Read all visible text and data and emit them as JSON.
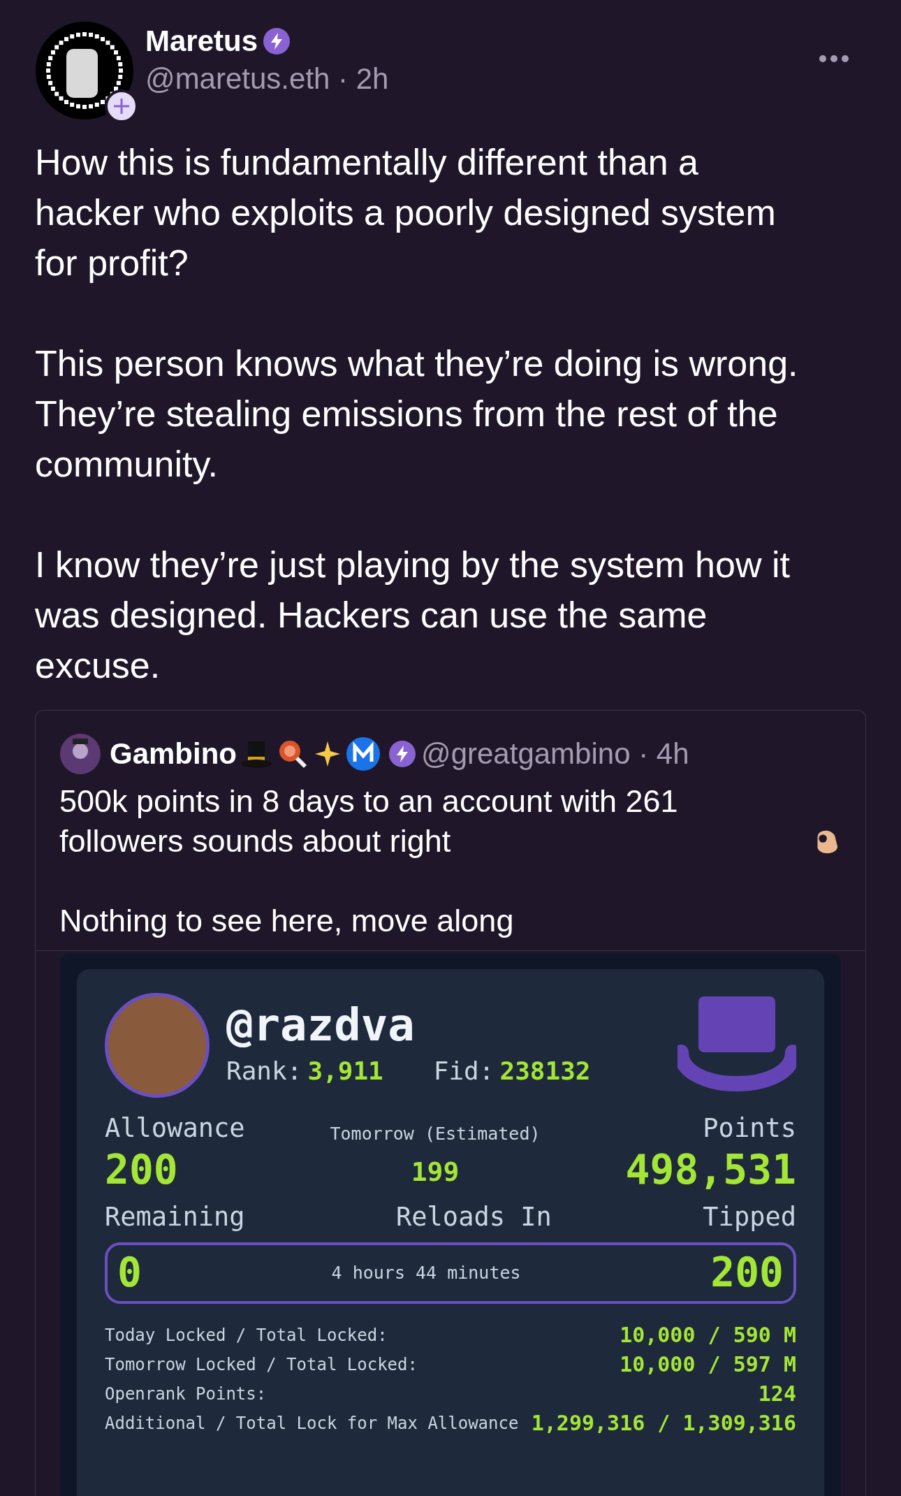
{
  "post": {
    "author": {
      "name": "Maretus",
      "handle_time": "@maretus.eth · 2h"
    },
    "paragraphs": [
      "How this is fundamentally different than a hacker who exploits a poorly designed system for profit?",
      "This person knows what they’re doing is wrong. They’re stealing emissions from the rest of the community.",
      "I know they’re just playing by the system how it was designed. Hackers can use the same excuse."
    ]
  },
  "quote": {
    "author": {
      "name": "Gambino",
      "handle_time": "@greatgambino · 4h"
    },
    "paragraphs": [
      "500k points in 8 days to an account with 261 followers sounds about right",
      "Nothing to see here, move along"
    ]
  },
  "embed": {
    "username": "@razdva",
    "rank_label": "Rank:",
    "rank": "3,911",
    "fid_label": "Fid:",
    "fid": "238132",
    "stats": [
      {
        "label": "Allowance",
        "value": "200"
      },
      {
        "label": "Tomorrow (Estimated)",
        "value": "199"
      },
      {
        "label": "Points",
        "value": "498,531"
      }
    ],
    "counters": [
      {
        "label": "Remaining",
        "value": "0"
      },
      {
        "label": "Reloads In",
        "value": "4 hours 44 minutes"
      },
      {
        "label": "Tipped",
        "value": "200"
      }
    ],
    "locks": [
      {
        "label": "Today Locked / Total Locked:",
        "value": "10,000 / 590 M"
      },
      {
        "label": "Tomorrow Locked / Total Locked:",
        "value": "10,000 / 597 M"
      },
      {
        "label": "Openrank Points:",
        "value": "124"
      },
      {
        "label": "Additional / Total Lock for Max Allowance",
        "value": "1,299,316 / 1,309,316"
      }
    ]
  }
}
